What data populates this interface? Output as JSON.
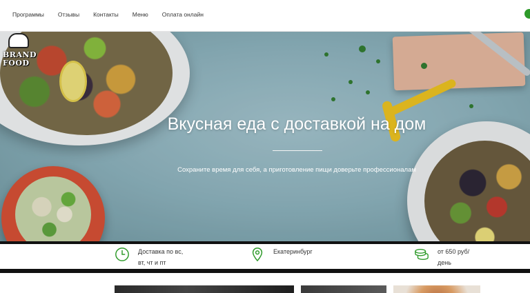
{
  "nav": {
    "items": [
      {
        "label": "Программы"
      },
      {
        "label": "Отзывы"
      },
      {
        "label": "Контакты"
      },
      {
        "label": "Меню"
      },
      {
        "label": "Оплата онлайн"
      }
    ]
  },
  "brand": {
    "line1": "BRAND",
    "line2": "FOOD"
  },
  "hero": {
    "title": "Вкусная еда с доставкой на дом",
    "subtitle": "Сохраните время для себя, а приготовление пищи доверьте профессионалам"
  },
  "features": {
    "delivery": {
      "line1": "Доставка по вс,",
      "line2": "вт, чт и пт",
      "icon": "clock-icon"
    },
    "location": {
      "line1": "Екатеринбург",
      "icon": "map-pin-icon"
    },
    "price": {
      "line1": "от 650 руб/",
      "line2": "день",
      "icon": "coins-icon"
    }
  },
  "colors": {
    "accent": "#2e9a2a"
  }
}
